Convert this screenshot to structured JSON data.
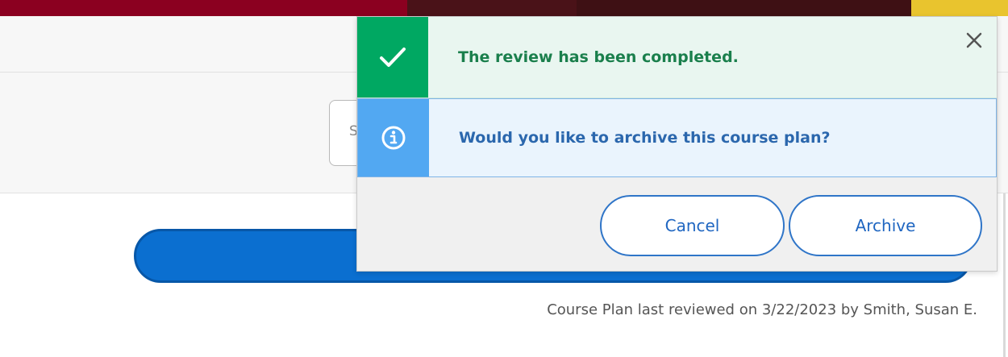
{
  "colors": {
    "header_segments": [
      "#8b0020",
      "#4a1218",
      "#3e1014",
      "#3e1014",
      "#e9c42e"
    ],
    "success": "#00a862",
    "info": "#52a8f2",
    "primary": "#0b6fd0"
  },
  "search": {
    "visible_text": "S"
  },
  "footer": {
    "last_reviewed": "Course Plan last reviewed on 3/22/2023 by Smith, Susan E."
  },
  "modal": {
    "close_icon": "close-icon",
    "success": {
      "icon": "check-icon",
      "message": "The review has been completed."
    },
    "info": {
      "icon": "info-icon",
      "message": "Would you like to archive this course plan?"
    },
    "buttons": {
      "cancel": "Cancel",
      "archive": "Archive"
    }
  }
}
